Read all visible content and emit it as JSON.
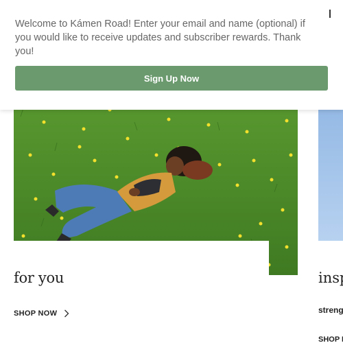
{
  "banner": {
    "message": "Welcome to Kámen Road! Enter your email and name (optional) if you would like to receive updates and subscriber rewards. Thank you!",
    "button_label": "Sign Up Now",
    "button_color": "#6b9a6e"
  },
  "cards": [
    {
      "title": "for you",
      "link_label": "SHOP NOW",
      "link_icon": "chevron-right-icon"
    },
    {
      "title": "insp",
      "subtitle": "streng",
      "link_label": "SHOP N"
    }
  ],
  "icons": {
    "close": "close-icon"
  }
}
